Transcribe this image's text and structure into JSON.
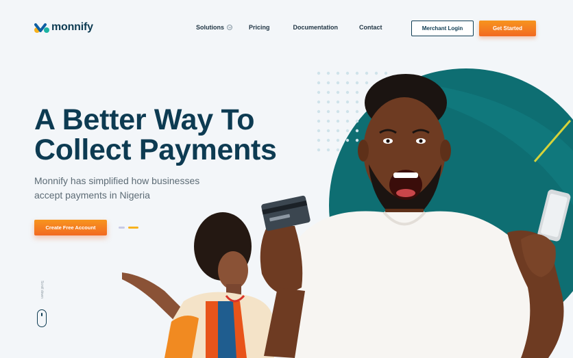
{
  "brand": {
    "name": "monnify"
  },
  "nav": {
    "items": [
      {
        "label": "Solutions",
        "has_dropdown": true
      },
      {
        "label": "Pricing"
      },
      {
        "label": "Documentation"
      },
      {
        "label": "Contact"
      }
    ],
    "merchant_login": "Merchant Login",
    "get_started": "Get Started"
  },
  "hero": {
    "headline_line1": "A Better Way To",
    "headline_line2": "Collect Payments",
    "subtext_line1": "Monnify has simplified how businesses",
    "subtext_line2": "accept payments in Nigeria",
    "cta": "Create Free Account",
    "scroll_label": "Scroll down",
    "slider_active_index": 1,
    "slider_count": 2
  },
  "colors": {
    "navy": "#0d3b52",
    "orange": "#f26a21",
    "teal": "#0e6e72",
    "background": "#f3f6f9",
    "slider_inactive": "#c6c9e6",
    "slider_active": "#f7b21e"
  },
  "icons": {
    "logo": "monnify-logo-icon",
    "dropdown": "chevron-down-icon",
    "mouse": "mouse-scroll-icon"
  }
}
